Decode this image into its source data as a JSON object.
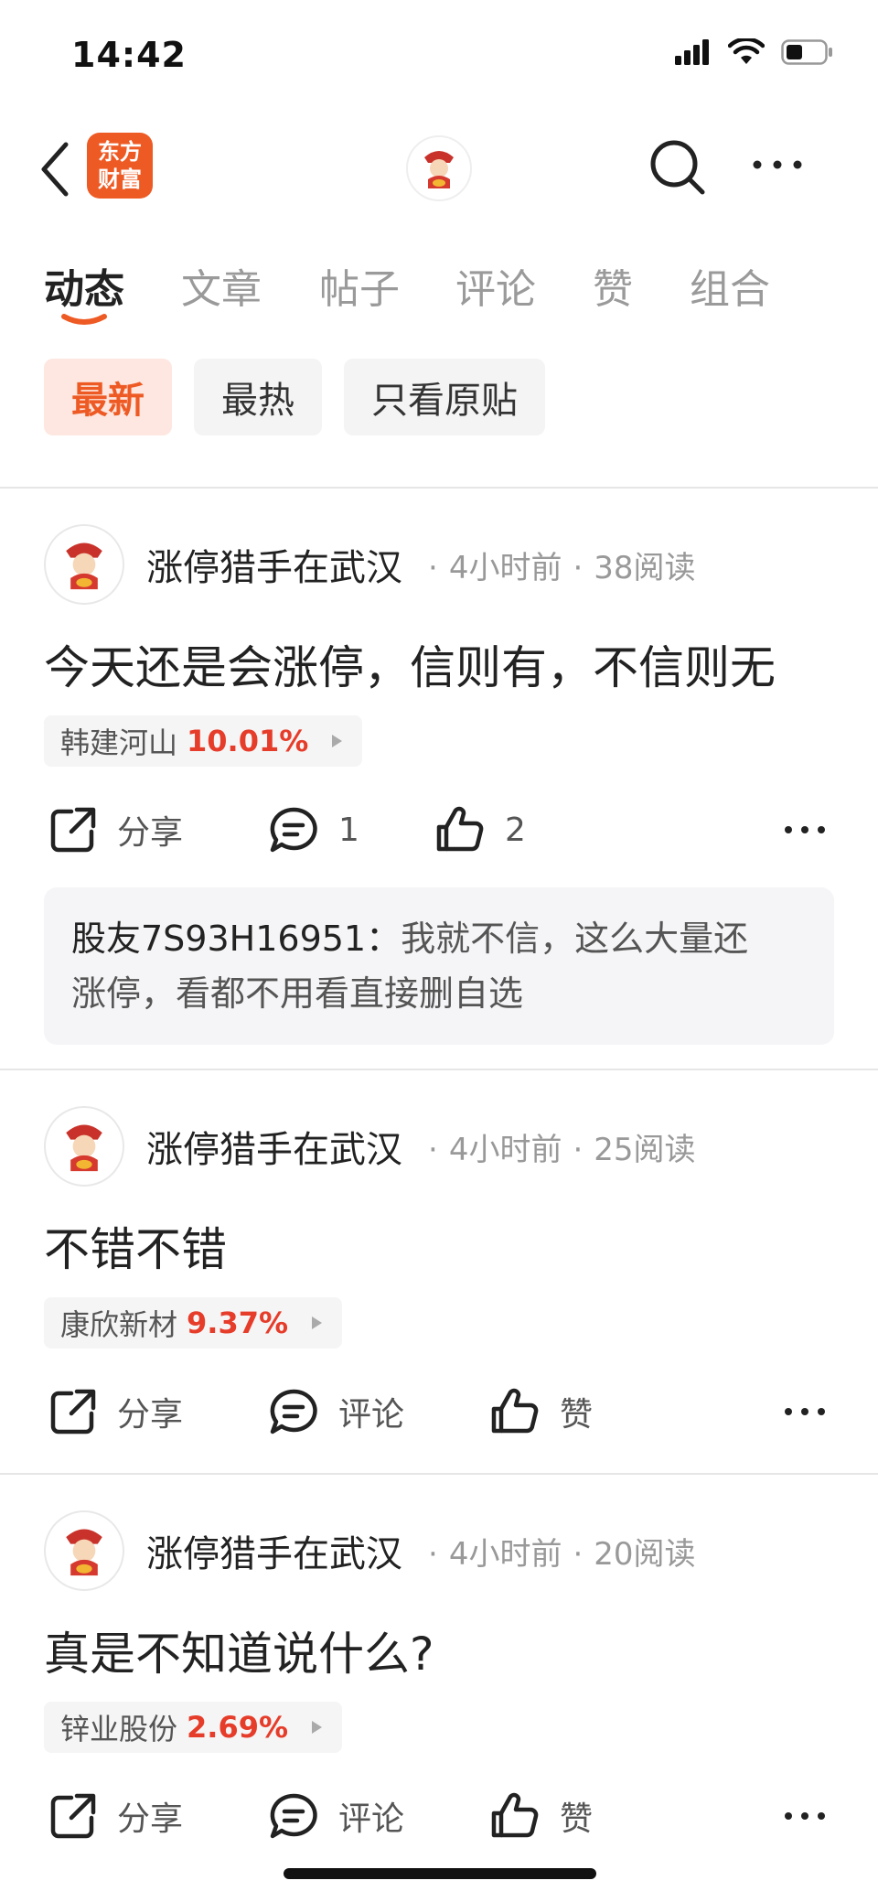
{
  "status": {
    "time": "14:42"
  },
  "header": {
    "logo_line1": "东方",
    "logo_line2": "财富"
  },
  "tabs": [
    {
      "label": "动态"
    },
    {
      "label": "文章"
    },
    {
      "label": "帖子"
    },
    {
      "label": "评论"
    },
    {
      "label": "赞"
    },
    {
      "label": "组合"
    }
  ],
  "filters": [
    {
      "label": "最新"
    },
    {
      "label": "最热"
    },
    {
      "label": "只看原贴"
    }
  ],
  "colors": {
    "accent": "#ee5a24",
    "gain": "#e63c2a"
  },
  "posts": [
    {
      "author": "涨停猎手在武汉",
      "time": "4小时前",
      "reads": "38阅读",
      "text": "今天还是会涨停，信则有，不信则无",
      "stock_name": "韩建河山",
      "stock_pct": "10.01%",
      "share_label": "分享",
      "comment_label": "1",
      "like_label": "2",
      "comment": {
        "author": "股友7S93H16951：",
        "line1": "我就不信，这么大量还",
        "line2": "涨停，看都不用看直接删自选"
      }
    },
    {
      "author": "涨停猎手在武汉",
      "time": "4小时前",
      "reads": "25阅读",
      "text": "不错不错",
      "stock_name": "康欣新材",
      "stock_pct": "9.37%",
      "share_label": "分享",
      "comment_label": "评论",
      "like_label": "赞"
    },
    {
      "author": "涨停猎手在武汉",
      "time": "4小时前",
      "reads": "20阅读",
      "text": "真是不知道说什么?",
      "stock_name": "锌业股份",
      "stock_pct": "2.69%",
      "share_label": "分享",
      "comment_label": "评论",
      "like_label": "赞"
    }
  ]
}
